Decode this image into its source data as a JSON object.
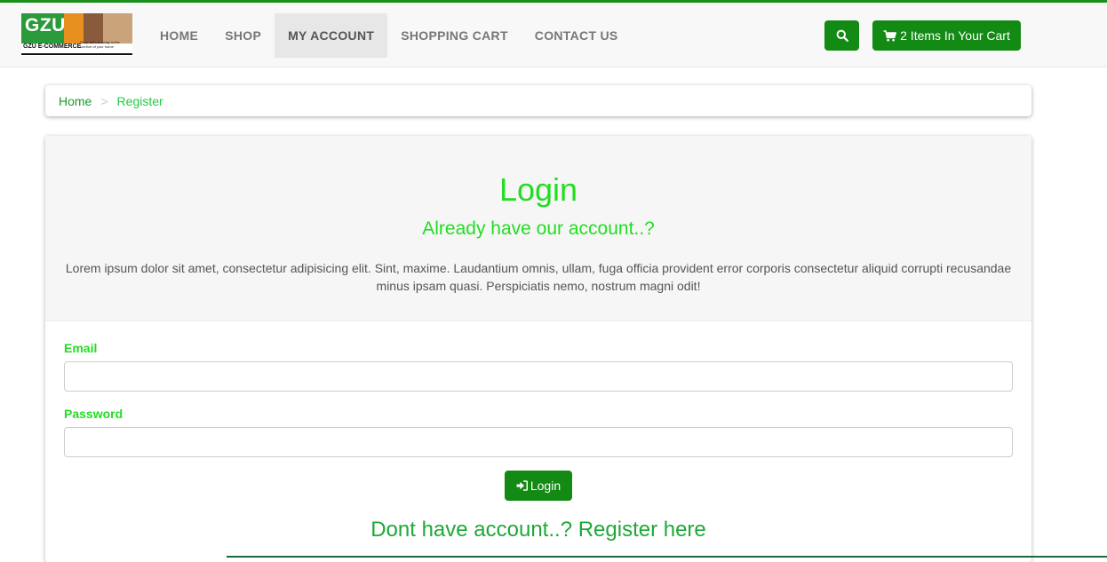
{
  "brand": {
    "logo_text": "GZU",
    "logo_subtext": "GZU E-COMMERCE",
    "logo_tagline": "Shop with us today in the comfort of your home"
  },
  "nav": {
    "items": [
      {
        "label": "HOME",
        "active": false
      },
      {
        "label": "SHOP",
        "active": false
      },
      {
        "label": "MY ACCOUNT",
        "active": true
      },
      {
        "label": "SHOPPING CART",
        "active": false
      },
      {
        "label": "CONTACT US",
        "active": false
      }
    ],
    "search_icon": "search-icon",
    "cart_icon": "cart-icon",
    "cart_label": "2 Items In Your Cart"
  },
  "breadcrumb": {
    "home": "Home",
    "separator": ">",
    "current": "Register"
  },
  "login": {
    "title": "Login",
    "subtitle": "Already have our account..?",
    "description": "Lorem ipsum dolor sit amet, consectetur adipisicing elit. Sint, maxime. Laudantium omnis, ullam, fuga officia provident error corporis consectetur aliquid corrupti recusandae minus ipsam quasi. Perspiciatis nemo, nostrum magni odit!",
    "email_label": "Email",
    "email_value": "",
    "password_label": "Password",
    "password_value": "",
    "button_label": "Login",
    "button_icon": "sign-in-icon",
    "register_link": "Dont have account..? Register here"
  },
  "colors": {
    "accent": "#138a13",
    "heading_green": "#22dd22",
    "link_green": "#1ea838"
  }
}
